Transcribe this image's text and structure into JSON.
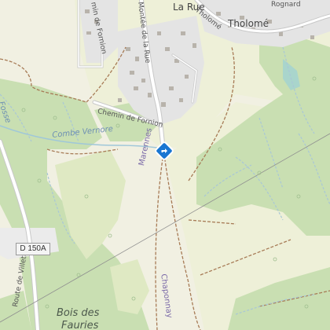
{
  "map": {
    "colors": {
      "background": "#f1f0e2",
      "forest": "#c9dfb2",
      "meadow": "#e6ecc9",
      "residential": "#d9d9d9",
      "building": "#b8b3ab",
      "road": "#ffffff",
      "trail": "#a77b56",
      "water": "#9fc7d9",
      "marker": "#1976d2"
    },
    "labels": {
      "la_rue": "La Rue",
      "tholome": "Tholomé",
      "tholome_road": "Tholomé",
      "rognard": "Rognard",
      "montee_de_la_rue": "Montée de la Rue",
      "chemin_de_fornion": "Chemin de Fornion",
      "chemin_fornion_top": "min de Fornion",
      "combe_vernore": "Combe Vernore",
      "fosse": "Fosse",
      "marennes": "Marennes",
      "chaponnay": "Chaponnay",
      "route_de_villette": "Route de Villette",
      "bois_des_fauries_1": "Bois des",
      "bois_des_fauries_2": "Fauries"
    },
    "road_shield": "D 150A",
    "marker_icon": "directions-diamond-icon"
  }
}
